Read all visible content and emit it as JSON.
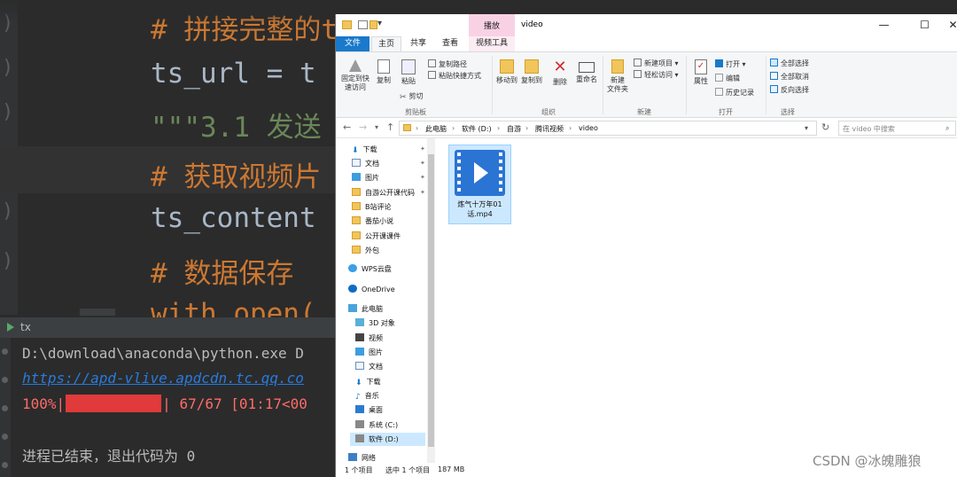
{
  "ide": {
    "code_lines": [
      {
        "kind": "comment",
        "text": "# 拼接完整的ts视频链接地址"
      },
      {
        "kind": "ident",
        "text": "ts_url = t"
      },
      {
        "kind": "str",
        "text": "\"\"\"3.1 发送"
      },
      {
        "kind": "comment",
        "text": "# 获取视频片"
      },
      {
        "kind": "ident",
        "text": "ts_content"
      },
      {
        "kind": "comment",
        "text": "# 数据保存"
      },
      {
        "kind": "kw",
        "text": "with open("
      }
    ],
    "run_tab": "tx",
    "run_output": {
      "cmd": "D:\\download\\anaconda\\python.exe D",
      "url": "https://apd-vlive.apdcdn.tc.qq.co",
      "progress_percent": "100%|",
      "progress_tail": "| 67/67 [01:17<00",
      "progress_fraction": 1.0,
      "exit_msg": "进程已结束，退出代码为 0"
    }
  },
  "explorer": {
    "title": "video",
    "context_tab_group": "播放",
    "ribbon_tabs": [
      "文件",
      "主页",
      "共享",
      "查看",
      "视频工具"
    ],
    "window_buttons": {
      "minimize": "—",
      "maximize": "☐",
      "close": "✕"
    },
    "ribbon": {
      "pin_quick_access": "固定到快\n速访问",
      "copy": "复制",
      "paste": "粘贴",
      "copy_path": "复制路径",
      "paste_shortcut": "粘贴快捷方式",
      "cut": "剪切",
      "group_clipboard": "剪贴板",
      "move_to": "移动到",
      "copy_to": "复制到",
      "delete": "删除",
      "rename": "重命名",
      "group_organize": "组织",
      "new_folder": "新建\n文件夹",
      "new_item": "新建项目",
      "easy_access": "轻松访问",
      "group_new": "新建",
      "properties": "属性",
      "open": "打开",
      "edit": "编辑",
      "history": "历史记录",
      "group_open": "打开",
      "select_all": "全部选择",
      "select_none": "全部取消",
      "invert_selection": "反向选择",
      "group_select": "选择"
    },
    "breadcrumbs": [
      "此电脑",
      "软件 (D:)",
      "自游",
      "腾讯视频",
      "video"
    ],
    "search_placeholder": "在 video 中搜索",
    "nav_items": [
      {
        "label": "下载",
        "icon": "download-icon",
        "pinned": true
      },
      {
        "label": "文档",
        "icon": "document-icon",
        "pinned": true
      },
      {
        "label": "图片",
        "icon": "picture-icon",
        "pinned": true
      },
      {
        "label": "自游公开课代码",
        "icon": "folder-icon",
        "pinned": true
      },
      {
        "label": "B站评论",
        "icon": "folder-icon",
        "pinned": false
      },
      {
        "label": "番茄小说",
        "icon": "folder-icon",
        "pinned": false
      },
      {
        "label": "公开课课件",
        "icon": "folder-icon",
        "pinned": false
      },
      {
        "label": "外包",
        "icon": "folder-icon",
        "pinned": false
      },
      {
        "label": "WPS云盘",
        "icon": "cloud-icon",
        "pinned": false
      },
      {
        "label": "OneDrive",
        "icon": "onedrive-icon",
        "pinned": false
      },
      {
        "label": "此电脑",
        "icon": "computer-icon",
        "pinned": false
      },
      {
        "label": "3D 对象",
        "icon": "cube-icon",
        "pinned": false
      },
      {
        "label": "视频",
        "icon": "video-folder-icon",
        "pinned": false
      },
      {
        "label": "图片",
        "icon": "picture-icon",
        "pinned": false
      },
      {
        "label": "文档",
        "icon": "document-icon",
        "pinned": false
      },
      {
        "label": "下载",
        "icon": "download-icon",
        "pinned": false
      },
      {
        "label": "音乐",
        "icon": "music-icon",
        "pinned": false
      },
      {
        "label": "桌面",
        "icon": "desktop-icon",
        "pinned": false
      },
      {
        "label": "系统 (C:)",
        "icon": "drive-icon",
        "pinned": false
      },
      {
        "label": "软件 (D:)",
        "icon": "drive-icon",
        "pinned": false
      },
      {
        "label": "网络",
        "icon": "network-icon",
        "pinned": false
      }
    ],
    "file": {
      "name": "炼气十万年01话.mp4",
      "icon": "video-file-icon"
    },
    "status": {
      "item_count": "1 个项目",
      "selected": "选中 1 个项目",
      "size": "187 MB"
    }
  },
  "watermark": "CSDN @冰魄雕狼",
  "colors": {
    "ide_bg": "#2b2b2b",
    "comment": "#cc7832",
    "progress_red": "#ff6b68",
    "explorer_accent": "#1979ca",
    "selection": "#cce8ff"
  }
}
